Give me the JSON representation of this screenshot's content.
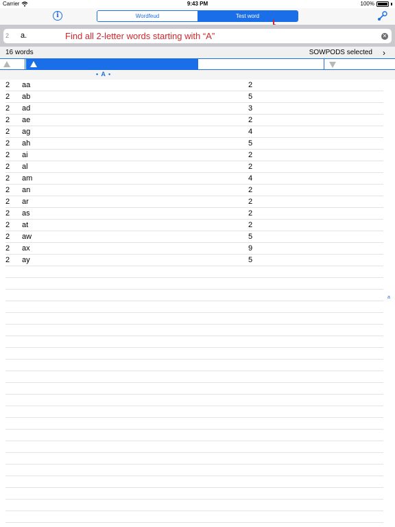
{
  "status_bar": {
    "carrier": "Carrier",
    "time": "9:43 PM",
    "battery": "100%"
  },
  "nav": {
    "info_icon": "info-icon",
    "segments": [
      {
        "label": "Wordfeud",
        "selected": false
      },
      {
        "label": "Test word",
        "selected": true
      }
    ],
    "settings_icon": "wrench-icon"
  },
  "search": {
    "prefix": "2",
    "value": "a.",
    "hint": "Find all 2-letter words starting with “A”"
  },
  "info_bar": {
    "count": "16 words",
    "dictionary": "SOWPODS selected",
    "chevron": "›"
  },
  "section": {
    "label": "• A •"
  },
  "rows": [
    {
      "len": "2",
      "word": "aa",
      "score": "2"
    },
    {
      "len": "2",
      "word": "ab",
      "score": "5"
    },
    {
      "len": "2",
      "word": "ad",
      "score": "3"
    },
    {
      "len": "2",
      "word": "ae",
      "score": "2"
    },
    {
      "len": "2",
      "word": "ag",
      "score": "4"
    },
    {
      "len": "2",
      "word": "ah",
      "score": "5"
    },
    {
      "len": "2",
      "word": "ai",
      "score": "2"
    },
    {
      "len": "2",
      "word": "al",
      "score": "2"
    },
    {
      "len": "2",
      "word": "am",
      "score": "4"
    },
    {
      "len": "2",
      "word": "an",
      "score": "2"
    },
    {
      "len": "2",
      "word": "ar",
      "score": "2"
    },
    {
      "len": "2",
      "word": "as",
      "score": "2"
    },
    {
      "len": "2",
      "word": "at",
      "score": "2"
    },
    {
      "len": "2",
      "word": "aw",
      "score": "5"
    },
    {
      "len": "2",
      "word": "ax",
      "score": "9"
    },
    {
      "len": "2",
      "word": "ay",
      "score": "5"
    }
  ],
  "index_letter": "a",
  "colors": {
    "accent": "#1a6ee8",
    "hint": "#d0262c"
  }
}
